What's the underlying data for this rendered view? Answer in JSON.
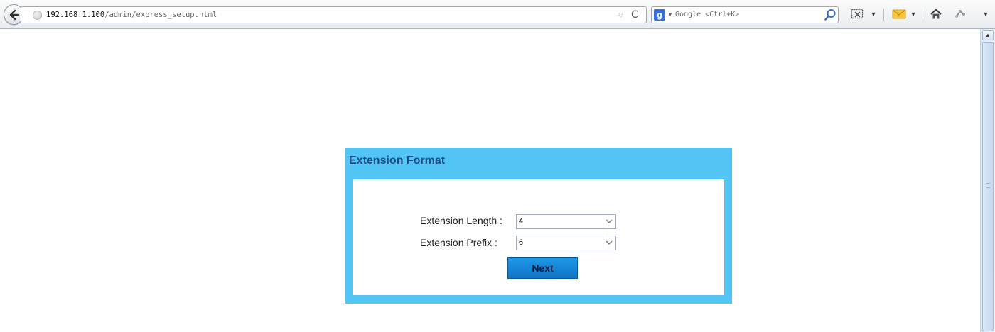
{
  "browser": {
    "url_host": "192.168.1.100",
    "url_path": "/admin/express_setup.html",
    "search_placeholder": "Google <Ctrl+K>"
  },
  "panel": {
    "title": "Extension Format",
    "fields": [
      {
        "label": "Extension Length :",
        "value": "4"
      },
      {
        "label": "Extension Prefix :",
        "value": "6"
      }
    ],
    "next_label": "Next"
  },
  "colors": {
    "panel_bg": "#53c5f5",
    "title_color": "#1f4f8a",
    "button_bg": "#1185d4"
  },
  "icons": [
    "back-arrow-icon",
    "globe-icon",
    "dropmark-icon",
    "reload-icon",
    "google-icon",
    "magnifier-icon",
    "screenshot-icon",
    "mail-icon",
    "home-icon",
    "extension-icon",
    "menu-dropdown-icon"
  ]
}
